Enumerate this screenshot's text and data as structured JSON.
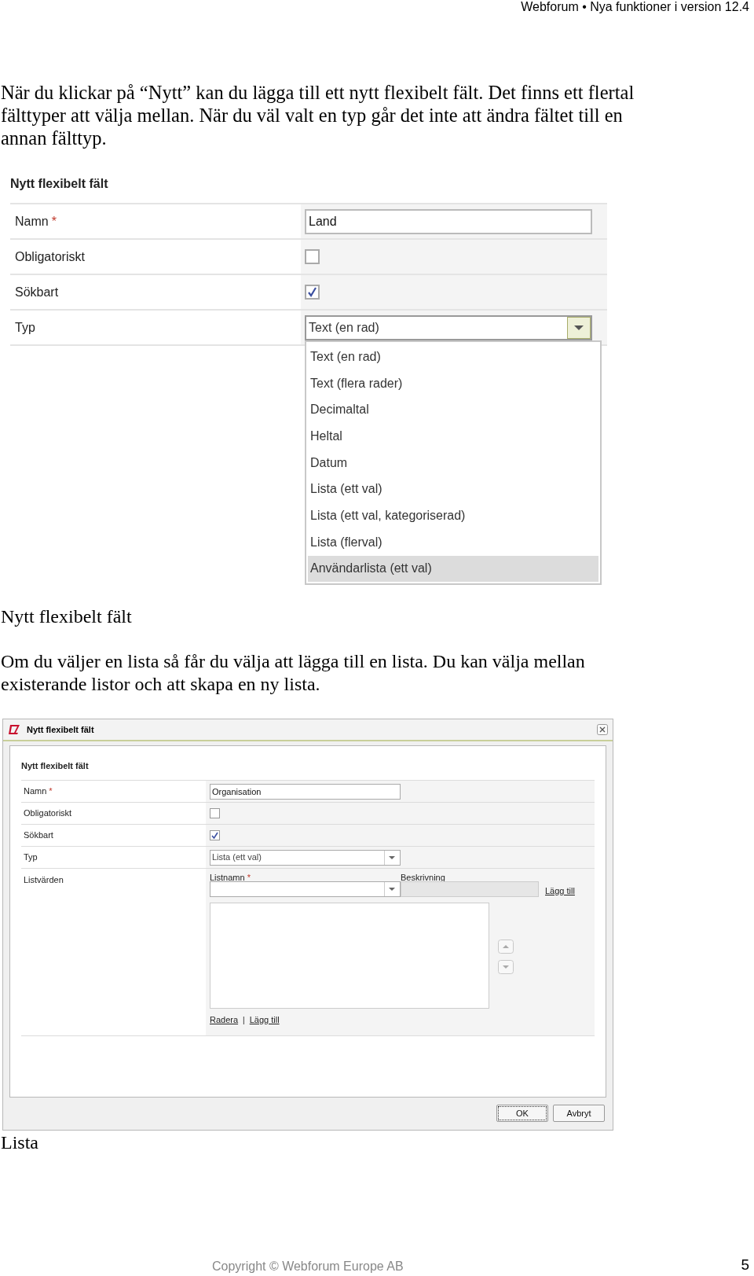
{
  "header": {
    "title": "Webforum • Nya funktioner i version 12.4"
  },
  "intro": "När du klickar på “Nytt” kan du lägga till ett nytt flexibelt fält. Det finns ett flertal fälttyper att välja mellan. När du väl valt en typ går det inte att ändra fältet till en annan fälttyp.",
  "figure1": {
    "heading": "Nytt flexibelt fält",
    "fields": [
      {
        "kind": "text",
        "label": "Namn",
        "required_mark": "*",
        "value": "Land"
      },
      {
        "kind": "checkbox",
        "label": "Obligatoriskt",
        "checked": false
      },
      {
        "kind": "checkbox",
        "label": "Sökbart",
        "checked": true
      },
      {
        "kind": "select",
        "label": "Typ",
        "value": "Text (en rad)",
        "expanded": true
      }
    ],
    "options": [
      {
        "label": "Text (en rad)",
        "selected": false
      },
      {
        "label": "Text (flera rader)",
        "selected": false
      },
      {
        "label": "Decimaltal",
        "selected": false
      },
      {
        "label": "Heltal",
        "selected": false
      },
      {
        "label": "Datum",
        "selected": false
      },
      {
        "label": "Lista (ett val)",
        "selected": false
      },
      {
        "label": "Lista (ett val, kategoriserad)",
        "selected": false
      },
      {
        "label": "Lista (flerval)",
        "selected": false
      },
      {
        "label": "Användarlista (ett val)",
        "selected": true
      }
    ]
  },
  "caption1": "Nytt flexibelt fält",
  "paragraph2": "Om du väljer en lista så får du välja att lägga till en lista. Du kan välja mellan existerande listor och att skapa en ny lista.",
  "dialog": {
    "title": "Nytt flexibelt fält",
    "heading": "Nytt flexibelt fält",
    "fields": [
      {
        "kind": "text",
        "label": "Namn",
        "required_mark": "*",
        "value": "Organisation"
      },
      {
        "kind": "checkbox",
        "label": "Obligatoriskt",
        "checked": false
      },
      {
        "kind": "checkbox",
        "label": "Sökbart",
        "checked": true
      },
      {
        "kind": "select",
        "label": "Typ",
        "value": "Lista (ett val)"
      },
      {
        "kind": "list_values",
        "label": "Listvärden",
        "list_name_label": "Listnamn",
        "required_mark": "*",
        "description_label": "Beskrivning",
        "add_link": "Lägg till",
        "delete_link": "Radera",
        "separator": "|",
        "add_item_link": "Lägg till"
      }
    ],
    "buttons": [
      "OK",
      "Avbryt"
    ]
  },
  "caption2": "Lista",
  "footer": {
    "copyright": "Copyright © Webforum Europe AB",
    "page": "5"
  }
}
